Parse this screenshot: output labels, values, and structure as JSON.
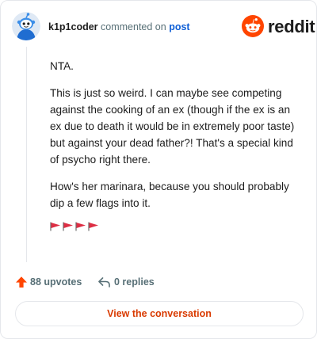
{
  "header": {
    "username": "k1p1coder",
    "action_text": "commented on",
    "post_link": "post",
    "avatar_icon": "snoo-avatar-icon",
    "brand": {
      "wordmark": "reddit",
      "logo_icon": "reddit-snoo-logo-icon",
      "brand_color": "#ff4500"
    }
  },
  "comment": {
    "paragraphs": [
      "NTA.",
      "This is just so weird. I can maybe see competing against the cooking of an ex (though if the ex is an ex due to death it would be in extremely poor taste) but against your dead father?! That's a special kind of psycho right there.",
      "How's her marinara, because you should probably dip a few flags into it."
    ],
    "flags": [
      "🚩",
      "🚩",
      "🚩",
      "🚩"
    ]
  },
  "actions": {
    "upvotes_label": "88 upvotes",
    "upvote_icon": "upvote-arrow-icon",
    "upvote_color": "#ff4500",
    "replies_label": "0 replies",
    "reply_icon": "reply-arrow-icon"
  },
  "cta": {
    "label": "View the conversation",
    "color": "#d93a00"
  }
}
